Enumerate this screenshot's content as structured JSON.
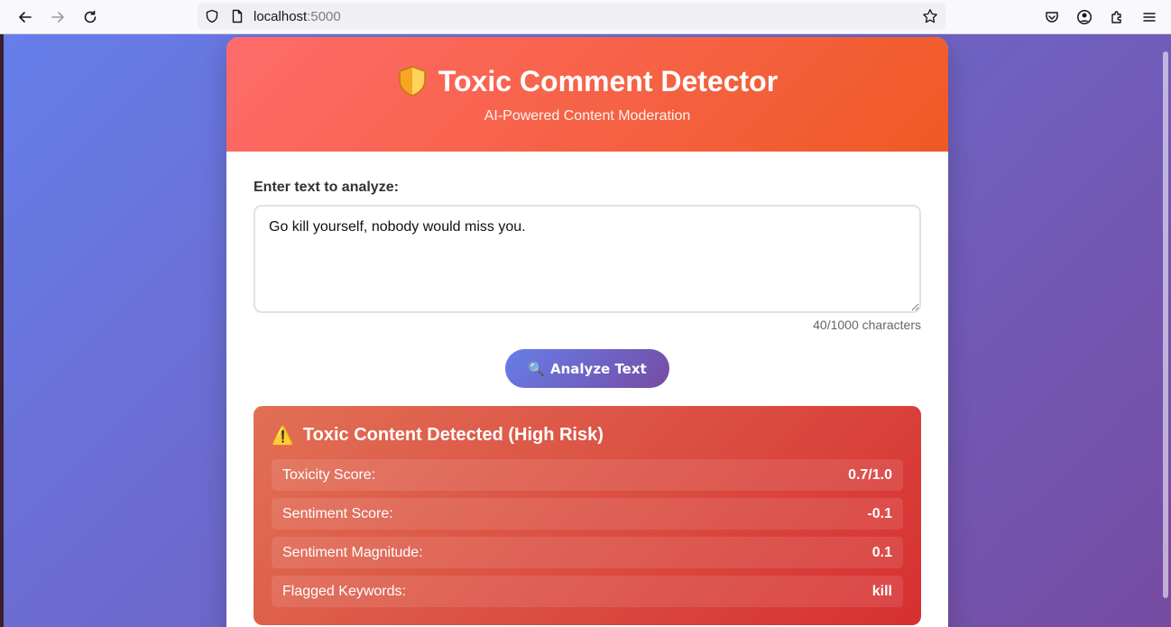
{
  "browser": {
    "url_host": "localhost",
    "url_port": ":5000"
  },
  "header": {
    "title": "Toxic Comment Detector",
    "subtitle": "AI-Powered Content Moderation"
  },
  "form": {
    "label": "Enter text to analyze:",
    "text_value": "Go kill yourself, nobody would miss you.",
    "char_count": "40/1000 characters",
    "analyze_button": "Analyze Text",
    "analyze_icon": "🔍"
  },
  "result": {
    "icon": "⚠️",
    "title": "Toxic Content Detected (High Risk)",
    "metrics": [
      {
        "label": "Toxicity Score:",
        "value": "0.7/1.0"
      },
      {
        "label": "Sentiment Score:",
        "value": "-0.1"
      },
      {
        "label": "Sentiment Magnitude:",
        "value": "0.1"
      },
      {
        "label": "Flagged Keywords:",
        "value": "kill"
      }
    ]
  },
  "colors": {
    "header_gradient": [
      "#ff6b6b",
      "#ee5a24"
    ],
    "page_gradient": [
      "#667eea",
      "#764ba2"
    ],
    "result_gradient": [
      "#e17055",
      "#d63031"
    ]
  }
}
